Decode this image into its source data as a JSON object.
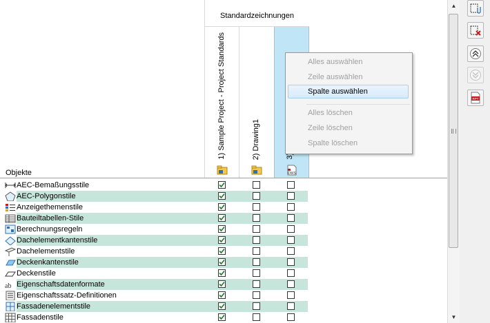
{
  "grid": {
    "objects_header": "Objekte",
    "column_group_title": "Standardzeichnungen",
    "columns": [
      {
        "label": "1) Sample Project - Project Standards",
        "icon": "project-folder-icon"
      },
      {
        "label": "2) Drawing1",
        "icon": "drawing-folder-icon"
      },
      {
        "label": "3) ...ds",
        "icon": "dws-file-icon",
        "icon_text": "DWS"
      }
    ],
    "rows": [
      {
        "label": "AEC-Bemaßungsstile",
        "icon": "dimension-style-icon",
        "checks": [
          true,
          false,
          false
        ],
        "highlight": false
      },
      {
        "label": "AEC-Polygonstile",
        "icon": "polygon-style-icon",
        "checks": [
          true,
          false,
          false
        ],
        "highlight": true
      },
      {
        "label": "Anzeigethemenstile",
        "icon": "display-theme-icon",
        "checks": [
          true,
          false,
          false
        ],
        "highlight": false
      },
      {
        "label": "Bauteiltabellen-Stile",
        "icon": "schedule-table-icon",
        "checks": [
          true,
          false,
          false
        ],
        "highlight": true
      },
      {
        "label": "Berechnungsregeln",
        "icon": "calculation-rules-icon",
        "checks": [
          true,
          false,
          false
        ],
        "highlight": false
      },
      {
        "label": "Dachelementkantenstile",
        "icon": "roof-slab-edge-icon",
        "checks": [
          true,
          false,
          false
        ],
        "highlight": true
      },
      {
        "label": "Dachelementstile",
        "icon": "roof-slab-icon",
        "checks": [
          true,
          false,
          false
        ],
        "highlight": false
      },
      {
        "label": "Deckenkantenstile",
        "icon": "slab-edge-icon",
        "checks": [
          true,
          false,
          false
        ],
        "highlight": true
      },
      {
        "label": "Deckenstile",
        "icon": "slab-style-icon",
        "checks": [
          true,
          false,
          false
        ],
        "highlight": false
      },
      {
        "label": "Eigenschaftsdatenformate",
        "icon": "property-format-icon",
        "checks": [
          true,
          false,
          false
        ],
        "highlight": true
      },
      {
        "label": "Eigenschaftssatz-Definitionen",
        "icon": "property-set-icon",
        "checks": [
          true,
          false,
          false
        ],
        "highlight": false
      },
      {
        "label": "Fassadenelementstile",
        "icon": "curtain-wall-unit-icon",
        "checks": [
          true,
          false,
          false
        ],
        "highlight": true
      },
      {
        "label": "Fassadenstile",
        "icon": "curtain-wall-icon",
        "checks": [
          true,
          false,
          false
        ],
        "highlight": false
      }
    ]
  },
  "context_menu": {
    "items": [
      {
        "label": "Alles auswählen",
        "enabled": false
      },
      {
        "label": "Zeile auswählen",
        "enabled": false
      },
      {
        "label": "Spalte auswählen",
        "enabled": true,
        "hovered": true
      },
      {
        "label": "Alles löschen",
        "enabled": false
      },
      {
        "label": "Zeile löschen",
        "enabled": false
      },
      {
        "label": "Spalte löschen",
        "enabled": false
      }
    ]
  },
  "toolbar": {
    "buttons": [
      {
        "name": "attach-standards-button",
        "icon": "attach-drawing-icon"
      },
      {
        "name": "remove-standards-button",
        "icon": "remove-drawing-icon"
      },
      {
        "name": "move-up-button",
        "icon": "move-up-icon"
      },
      {
        "name": "move-down-button",
        "icon": "move-down-icon"
      },
      {
        "name": "report-button",
        "icon": "report-file-icon",
        "icon_text": "RPT"
      }
    ]
  },
  "colors": {
    "highlight_row": "#c6e6dc",
    "selected_column": "#bfe5f6",
    "menu_hover": "#d7ebfb",
    "report_icon": "#c8191e"
  }
}
